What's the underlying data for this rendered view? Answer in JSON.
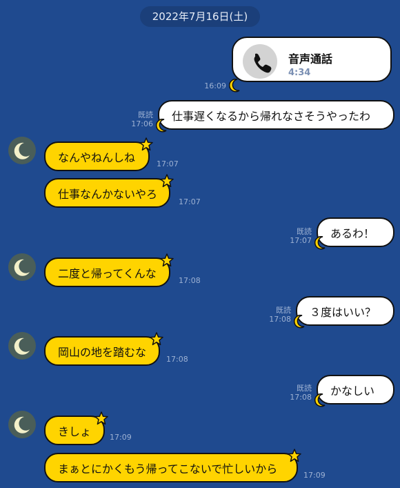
{
  "date_label": "2022年7月16日(土)",
  "call": {
    "title": "音声通話",
    "duration": "4:34",
    "time": "16:09"
  },
  "messages": [
    {
      "side": "out",
      "text": "仕事遅くなるから帰れなさそうやったわ",
      "read": "既読",
      "time": "17:06"
    },
    {
      "side": "in",
      "text": "なんやねんしね",
      "time": "17:07"
    },
    {
      "side": "in",
      "text": "仕事なんかないやろ",
      "time": "17:07"
    },
    {
      "side": "out",
      "text": "あるわ！",
      "read": "既読",
      "time": "17:07"
    },
    {
      "side": "in",
      "text": "二度と帰ってくんな",
      "time": "17:08"
    },
    {
      "side": "out",
      "text": "３度はいい？",
      "read": "既読",
      "time": "17:08"
    },
    {
      "side": "in",
      "text": "岡山の地を踏むな",
      "time": "17:08"
    },
    {
      "side": "out",
      "text": "かなしい",
      "read": "既読",
      "time": "17:08"
    },
    {
      "side": "in",
      "text": "きしょ",
      "time": "17:09"
    },
    {
      "side": "in",
      "text": "まぁとにかくもう帰ってこないで忙しいから",
      "time": "17:09"
    }
  ],
  "colors": {
    "background": "#1f4a8f",
    "incoming_bubble": "#ffd400",
    "outgoing_bubble": "#ffffff",
    "avatar_bg": "#4a5e59"
  }
}
